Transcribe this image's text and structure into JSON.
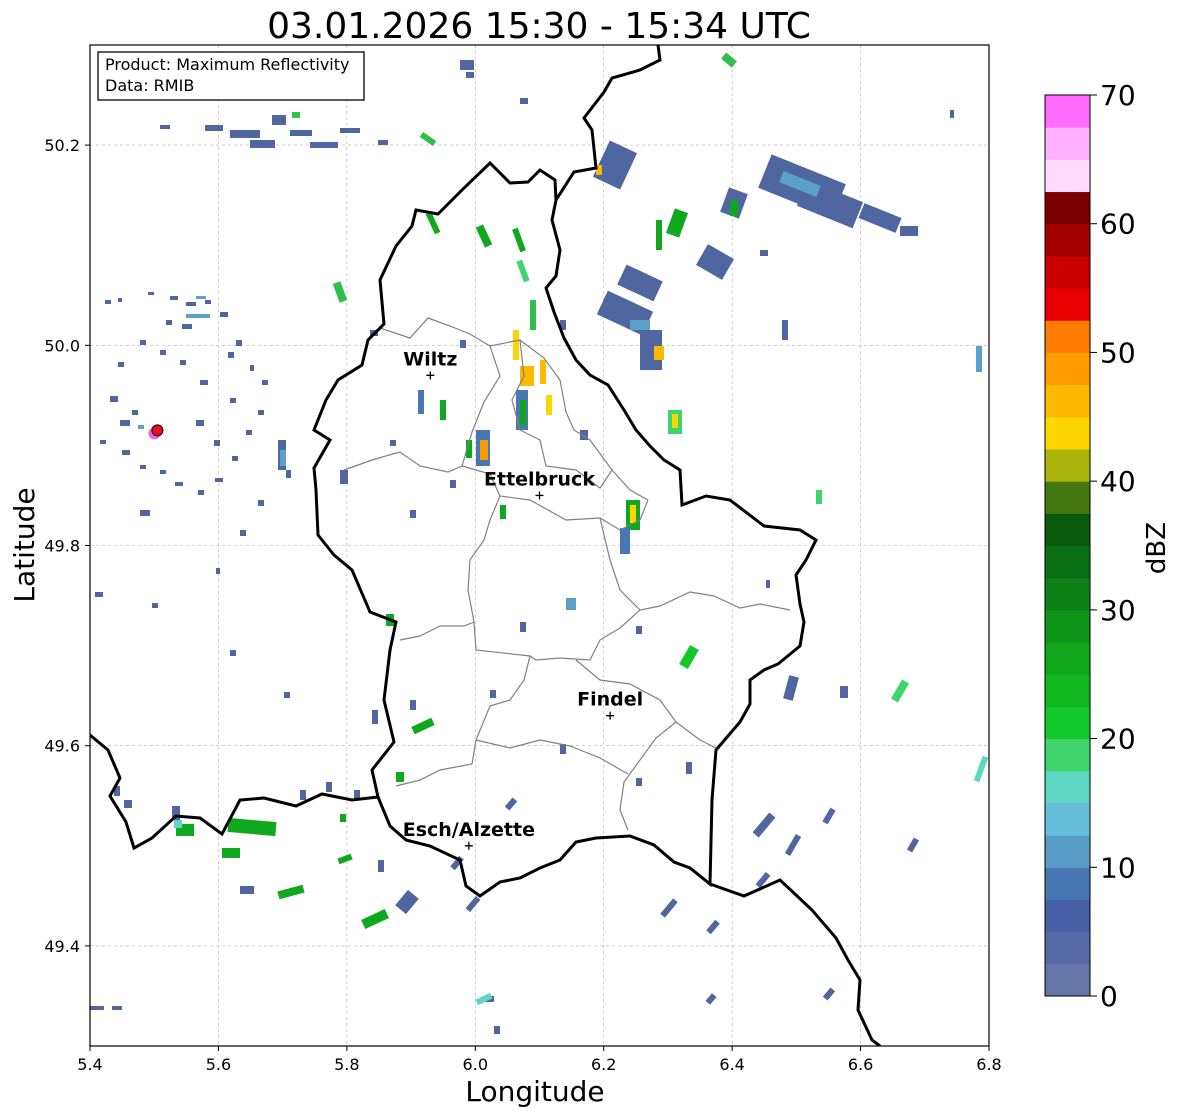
{
  "title": "03.01.2026 15:30 - 15:34 UTC",
  "info_box": {
    "product": "Product: Maximum Reflectivity",
    "data": "Data: RMIB"
  },
  "axes": {
    "xlabel": "Longitude",
    "ylabel": "Latitude",
    "xlim": [
      5.4,
      6.8
    ],
    "ylim": [
      49.3,
      50.3
    ],
    "xticks": [
      "5.4",
      "5.6",
      "5.8",
      "6.0",
      "6.2",
      "6.4",
      "6.6",
      "6.8"
    ],
    "yticks": [
      "49.4",
      "49.6",
      "49.8",
      "50.0",
      "50.2"
    ],
    "grid": true
  },
  "colorbar": {
    "label": "dBZ",
    "ticks": [
      "0",
      "10",
      "20",
      "30",
      "40",
      "50",
      "60",
      "70"
    ],
    "min": 0,
    "max": 70,
    "step": 2.5,
    "colors": [
      "#6475a8",
      "#556aa6",
      "#4760a6",
      "#4878b4",
      "#5a9cc8",
      "#66c0dc",
      "#5fd6c2",
      "#3fd46e",
      "#12c82a",
      "#10b81e",
      "#10a61a",
      "#0e9418",
      "#0c8216",
      "#0a6e12",
      "#0a5a0e",
      "#457810",
      "#aab40a",
      "#ffd600",
      "#ffb800",
      "#ff9c00",
      "#ff7c00",
      "#e80000",
      "#c80000",
      "#a40000",
      "#7a0000",
      "#ffdcff",
      "#ffb0ff",
      "#ff6cff",
      "#ee33ee"
    ]
  },
  "cities": [
    {
      "name": "Wiltz",
      "lon": 5.93,
      "lat": 49.97
    },
    {
      "name": "Ettelbruck",
      "lon": 6.1,
      "lat": 49.85
    },
    {
      "name": "Findel",
      "lon": 6.21,
      "lat": 49.63
    },
    {
      "name": "Esch/Alzette",
      "lon": 5.99,
      "lat": 49.5
    }
  ],
  "radar_site": {
    "lon": 5.505,
    "lat": 49.915,
    "color": "#e8101e"
  }
}
